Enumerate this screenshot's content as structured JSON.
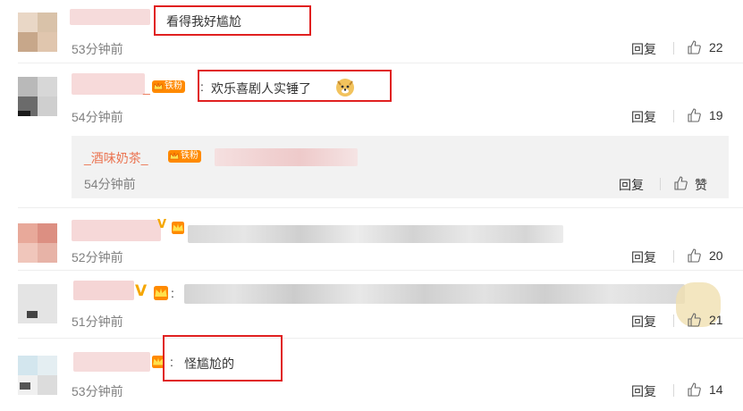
{
  "comments": [
    {
      "text": "看得我好尴尬",
      "time": "53分钟前",
      "reply": "回复",
      "likes": "22"
    },
    {
      "colon": ":",
      "text": "欢乐喜剧人实锤了",
      "emoji": "doge",
      "badge": "铁粉",
      "time": "54分钟前",
      "reply": "回复",
      "likes": "19"
    },
    {
      "time": "52分钟前",
      "reply": "回复",
      "likes": "20"
    },
    {
      "colon": ":",
      "badge_v": "V",
      "time": "51分钟前",
      "reply": "回复",
      "likes": "21"
    },
    {
      "colon": ":",
      "text": "怪尴尬的",
      "time": "53分钟前",
      "reply": "回复",
      "likes": "14"
    }
  ],
  "sub_reply": {
    "username": "_酒味奶茶_",
    "badge": "铁粉",
    "time": "54分钟前",
    "reply": "回复",
    "like_label": "赞"
  },
  "icons": {
    "like": "thumbs-up-icon",
    "crown": "crown-icon",
    "emoji": "doge-emoji-icon"
  },
  "colors": {
    "highlight_box": "#e02020",
    "username": "#eb7350",
    "badge": "#ff8a00",
    "vip": "#f5a600"
  }
}
